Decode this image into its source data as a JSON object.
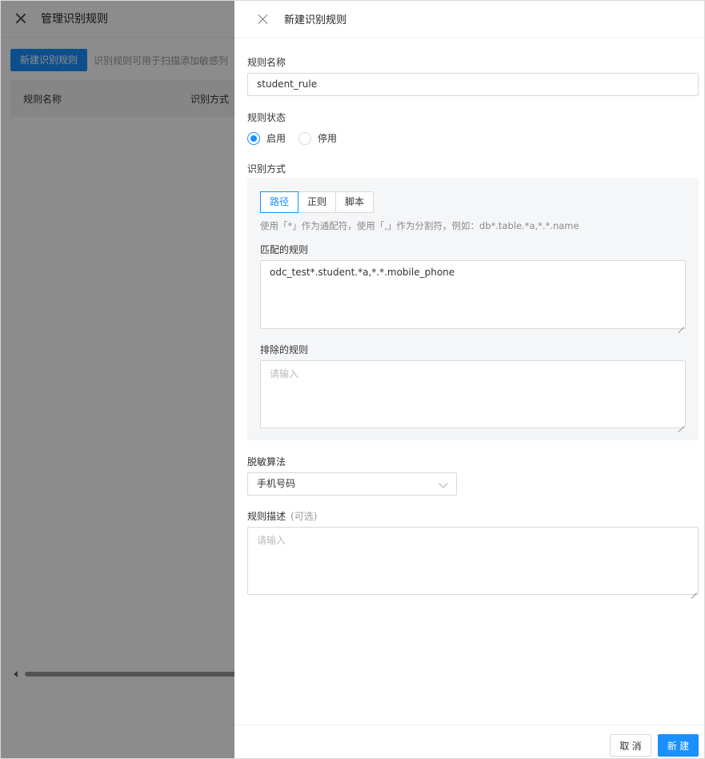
{
  "background": {
    "title": "管理识别规则",
    "new_button": "新建识别规则",
    "hint": "识别规则可用于扫描添加敏感列",
    "columns": [
      "规则名称",
      "识别方式"
    ]
  },
  "drawer": {
    "title": "新建识别规则",
    "rule_name": {
      "label": "规则名称",
      "value": "student_rule"
    },
    "rule_status": {
      "label": "规则状态",
      "options": [
        "启用",
        "停用"
      ],
      "selected": "启用"
    },
    "method": {
      "label": "识别方式",
      "tabs": [
        "路径",
        "正则",
        "脚本"
      ],
      "active_tab": "路径",
      "hint": "使用「*」作为通配符，使用「,」作为分割符，例如：db*.table.*a,*.*.name",
      "match_label": "匹配的规则",
      "match_value": "odc_test*.student.*a,*.*.mobile_phone",
      "exclude_label": "排除的规则",
      "exclude_placeholder": "请输入"
    },
    "algorithm": {
      "label": "脱敏算法",
      "value": "手机号码"
    },
    "description": {
      "label": "规则描述",
      "optional": "(可选)",
      "placeholder": "请输入"
    },
    "footer": {
      "cancel": "取 消",
      "submit": "新 建"
    }
  },
  "colors": {
    "primary": "#1890ff"
  }
}
